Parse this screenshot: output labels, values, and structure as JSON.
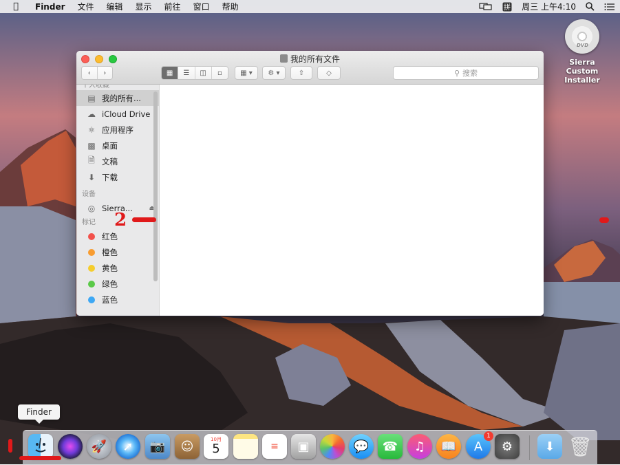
{
  "menubar": {
    "app_name": "Finder",
    "menus": [
      "文件",
      "编辑",
      "显示",
      "前往",
      "窗口",
      "帮助"
    ],
    "clock": "周三 上午4:10"
  },
  "desktop": {
    "dvd_label": "Sierra Custom Installer",
    "dvd_disc_text": "DVD"
  },
  "window": {
    "title": "我的所有文件",
    "search_placeholder": "搜索",
    "sidebar": {
      "favorites_header": "个人收藏",
      "favorites": [
        {
          "label": "我的所有...",
          "icon": "all-files-icon"
        },
        {
          "label": "iCloud Drive",
          "icon": "cloud-icon"
        },
        {
          "label": "应用程序",
          "icon": "applications-icon"
        },
        {
          "label": "桌面",
          "icon": "desktop-icon"
        },
        {
          "label": "文稿",
          "icon": "documents-icon"
        },
        {
          "label": "下载",
          "icon": "downloads-icon"
        }
      ],
      "devices_header": "设备",
      "devices": [
        {
          "label": "Sierra...",
          "icon": "disc-icon"
        }
      ],
      "tags_header": "标记",
      "tags": [
        {
          "label": "红色",
          "color": "#f2514b"
        },
        {
          "label": "橙色",
          "color": "#f89c30"
        },
        {
          "label": "黄色",
          "color": "#f5cd2d"
        },
        {
          "label": "绿色",
          "color": "#5ac948"
        },
        {
          "label": "蓝色",
          "color": "#3ea8f4"
        }
      ]
    }
  },
  "dock": {
    "tooltip": "Finder",
    "calendar_month": "10月",
    "calendar_day": "5",
    "app_store_badge": "1",
    "apps": [
      "Finder",
      "Siri",
      "Launchpad",
      "Safari",
      "Preview",
      "Contacts",
      "Calendar",
      "Notes",
      "Reminders",
      "Photo Booth",
      "Photos",
      "Messages",
      "FaceTime",
      "iTunes",
      "iBooks",
      "App Store",
      "System Preferences",
      "Downloads",
      "Trash"
    ]
  },
  "annotation": {
    "number": "2"
  },
  "colors": {
    "accent_red": "#e0191a"
  }
}
